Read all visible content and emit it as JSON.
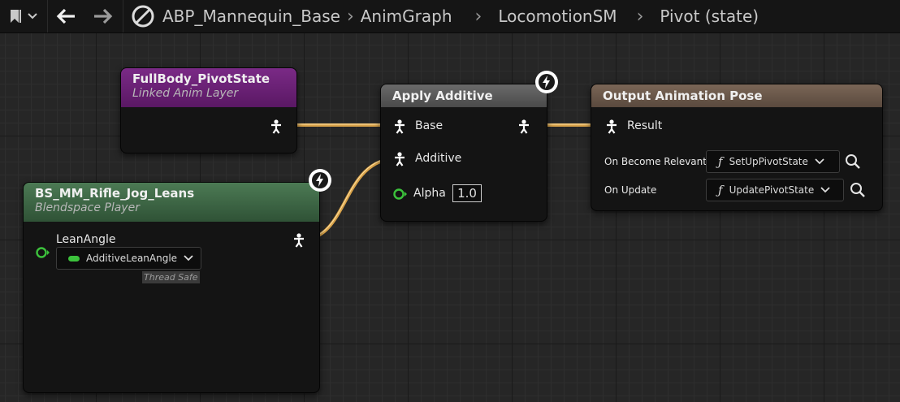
{
  "toolbar": {
    "breadcrumb": [
      "ABP_Mannequin_Base",
      "AnimGraph",
      "LocomotionSM",
      "Pivot (state)"
    ],
    "icons": [
      "bookmark-icon",
      "chevron-down-icon",
      "back-arrow-icon",
      "forward-arrow-icon",
      "graph-icon"
    ]
  },
  "nodes": {
    "pivot_state": {
      "title": "FullBody_PivotState",
      "subtitle": "Linked Anim Layer"
    },
    "blendspace": {
      "title": "BS_MM_Rifle_Jog_Leans",
      "subtitle": "Blendspace Player",
      "pin_label": "LeanAngle",
      "variable": "AdditiveLeanAngle",
      "tag": "Thread Safe"
    },
    "apply_additive": {
      "title": "Apply Additive",
      "pin_base": "Base",
      "pin_additive": "Additive",
      "pin_alpha": "Alpha",
      "alpha_value": "1.0"
    },
    "output": {
      "title": "Output Animation Pose",
      "pin_result": "Result",
      "relevant_label": "On Become Relevant",
      "relevant_func": "SetUpPivotState",
      "update_label": "On Update",
      "update_func": "UpdatePivotState"
    }
  },
  "colors": {
    "linked_layer_header": "#6a1d73",
    "blendspace_header": "#3f6b45",
    "apply_additive_header": "#5a5a5a",
    "output_header": "#6e5a4a",
    "pose_wire": "#d8a24a",
    "float_pin": "#3cc23c"
  }
}
